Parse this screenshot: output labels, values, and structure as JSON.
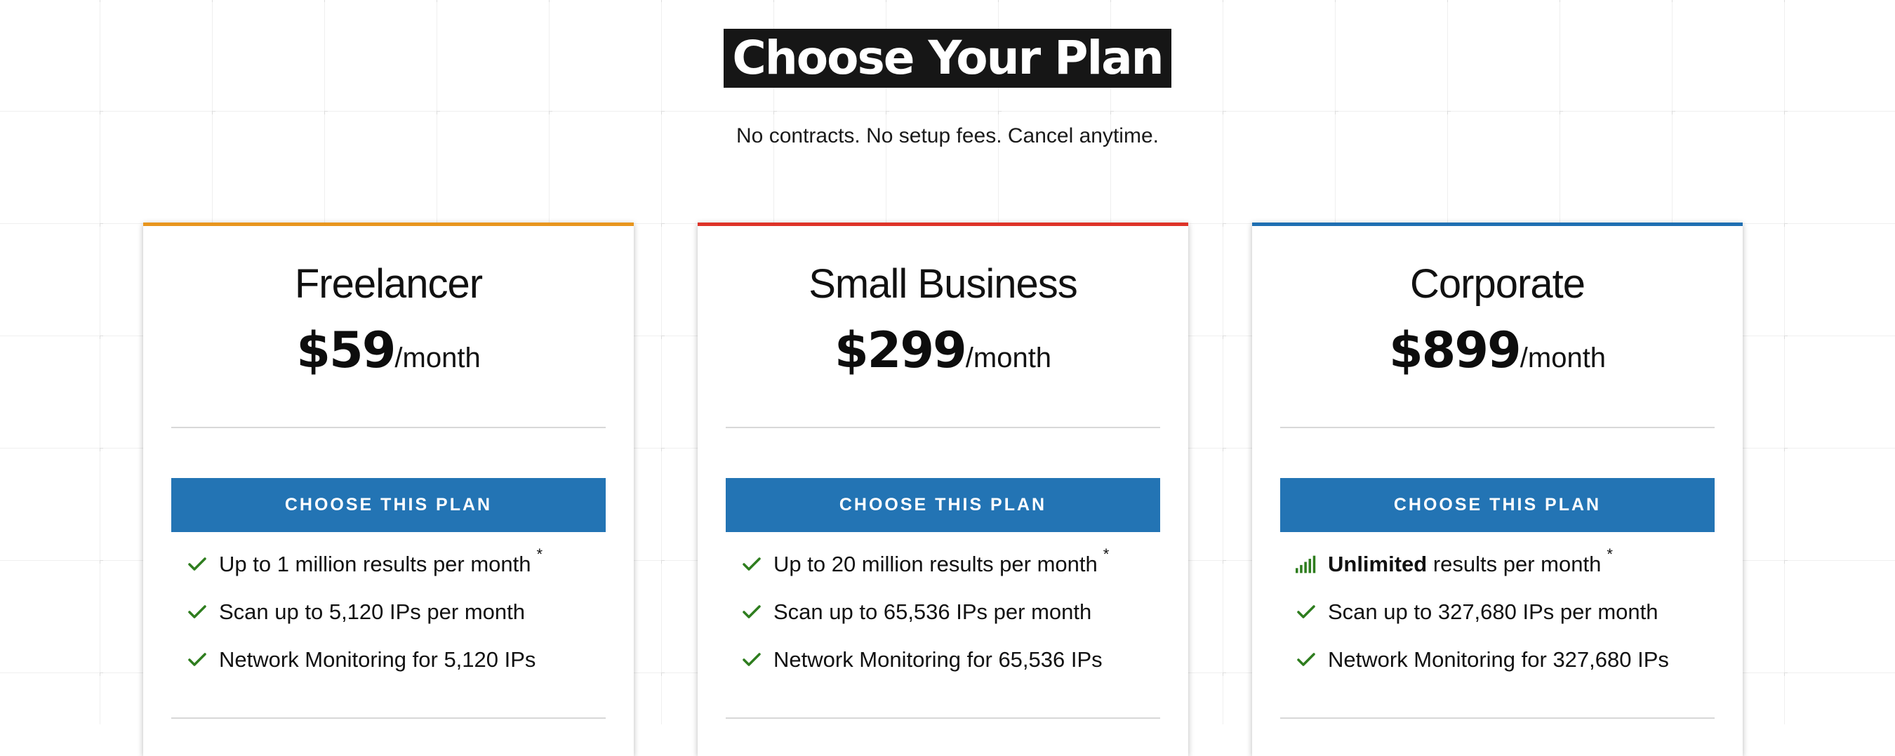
{
  "header": {
    "title": "Choose Your Plan",
    "subtitle": "No contracts. No setup fees. Cancel anytime."
  },
  "colors": {
    "button": "#2374b4",
    "check": "#2e7d1e",
    "freelancer_accent": "#e8961e",
    "small_business_accent": "#de3328",
    "corporate_accent": "#1f6fb2"
  },
  "plans": [
    {
      "name": "Freelancer",
      "price": "$59",
      "period": "/month",
      "button_label": "CHOOSE THIS PLAN",
      "accent_color": "#e8961e",
      "features": [
        {
          "icon": "check-icon",
          "strong": "",
          "text": "Up to 1 million results per month",
          "note": "*"
        },
        {
          "icon": "check-icon",
          "strong": "",
          "text": "Scan up to 5,120 IPs per month",
          "note": ""
        },
        {
          "icon": "check-icon",
          "strong": "",
          "text": "Network Monitoring for 5,120 IPs",
          "note": ""
        }
      ]
    },
    {
      "name": "Small Business",
      "price": "$299",
      "period": "/month",
      "button_label": "CHOOSE THIS PLAN",
      "accent_color": "#de3328",
      "features": [
        {
          "icon": "check-icon",
          "strong": "",
          "text": "Up to 20 million results per month",
          "note": "*"
        },
        {
          "icon": "check-icon",
          "strong": "",
          "text": "Scan up to 65,536 IPs per month",
          "note": ""
        },
        {
          "icon": "check-icon",
          "strong": "",
          "text": "Network Monitoring for 65,536 IPs",
          "note": ""
        }
      ]
    },
    {
      "name": "Corporate",
      "price": "$899",
      "period": "/month",
      "button_label": "CHOOSE THIS PLAN",
      "accent_color": "#1f6fb2",
      "features": [
        {
          "icon": "signal-bars-icon",
          "strong": "Unlimited",
          "text": " results per month",
          "note": "*"
        },
        {
          "icon": "check-icon",
          "strong": "",
          "text": "Scan up to 327,680 IPs per month",
          "note": ""
        },
        {
          "icon": "check-icon",
          "strong": "",
          "text": "Network Monitoring for 327,680 IPs",
          "note": ""
        }
      ]
    }
  ]
}
